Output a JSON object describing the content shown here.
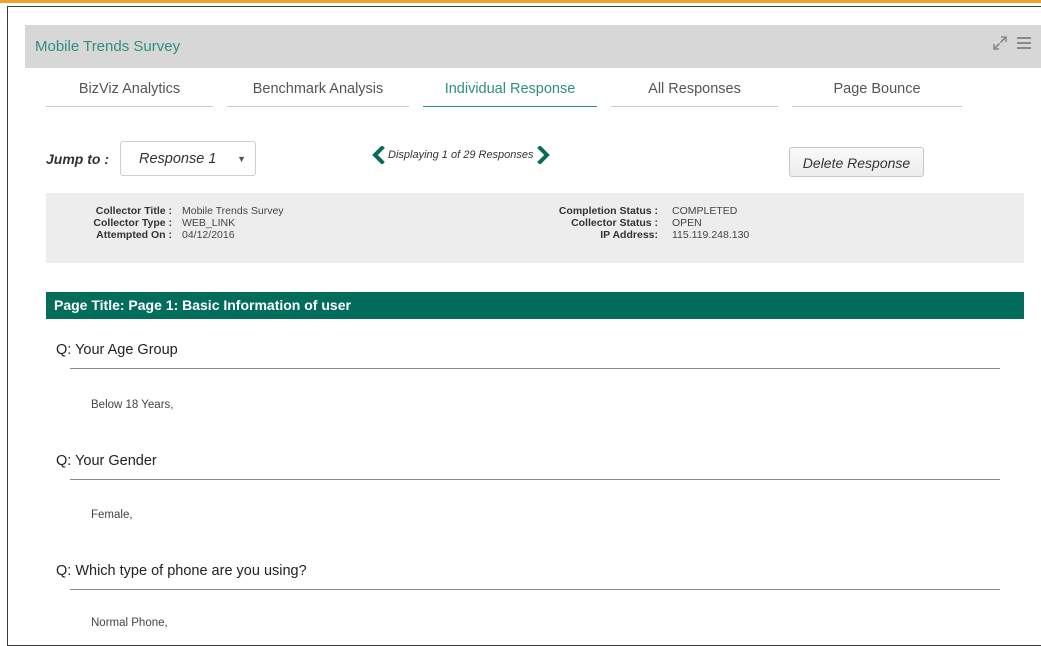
{
  "panel": {
    "title": "Mobile Trends Survey",
    "icons": [
      "expand-icon",
      "hamburger-menu-icon"
    ]
  },
  "tabs": [
    {
      "label": "BizViz Analytics",
      "active": false
    },
    {
      "label": "Benchmark Analysis",
      "active": false
    },
    {
      "label": "Individual Response",
      "active": true
    },
    {
      "label": "All Responses",
      "active": false
    },
    {
      "label": "Page Bounce",
      "active": false
    }
  ],
  "toolbar": {
    "jump_label": "Jump to :",
    "jump_value": "Response 1",
    "pager_text": "Displaying 1 of 29 Responses",
    "delete_label": "Delete Response"
  },
  "meta": {
    "left": [
      {
        "key": "Collector Title :",
        "value": "Mobile Trends Survey"
      },
      {
        "key": "Collector Type :",
        "value": "WEB_LINK"
      },
      {
        "key": "Attempted On :",
        "value": "04/12/2016"
      }
    ],
    "right": [
      {
        "key": "Completion Status :",
        "value": "COMPLETED"
      },
      {
        "key": "Collector Status :",
        "value": "OPEN"
      },
      {
        "key": "IP Address:",
        "value": "115.119.248.130"
      }
    ]
  },
  "page_title": "Page Title: Page 1: Basic Information of user",
  "questions": [
    {
      "question": "Q: Your Age Group",
      "answer": "Below 18 Years,"
    },
    {
      "question": "Q: Your Gender",
      "answer": "Female,"
    },
    {
      "question": "Q: Which type of phone are you using?",
      "answer": "Normal Phone,"
    }
  ],
  "colors": {
    "accent": "#2f8f7d",
    "page_title_bg": "#036d5c",
    "top_rule": "#f4a12a",
    "header_bg": "#d7d7d7"
  }
}
